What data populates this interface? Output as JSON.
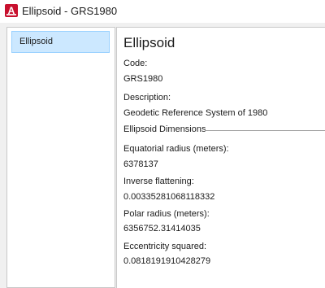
{
  "window": {
    "title": "Ellipsoid - GRS1980",
    "app_icon_letter": "A"
  },
  "sidebar": {
    "items": [
      {
        "label": "Ellipsoid",
        "selected": true
      }
    ]
  },
  "details": {
    "heading": "Ellipsoid",
    "code_label": "Code:",
    "code_value": "GRS1980",
    "description_label": "Description:",
    "description_value": "Geodetic Reference System of 1980",
    "section_title": "Ellipsoid Dimensions",
    "equatorial_label": "Equatorial radius (meters):",
    "equatorial_value": "6378137",
    "inverse_flattening_label": "Inverse flattening:",
    "inverse_flattening_value": "0.00335281068118332",
    "polar_label": "Polar radius (meters):",
    "polar_value": "6356752.31414035",
    "eccentricity_label": "Eccentricity squared:",
    "eccentricity_value": "0.0818191910428279"
  },
  "colors": {
    "app_icon": "#c8102e",
    "selection_fill": "#cce8ff",
    "selection_border": "#99d1ff"
  }
}
